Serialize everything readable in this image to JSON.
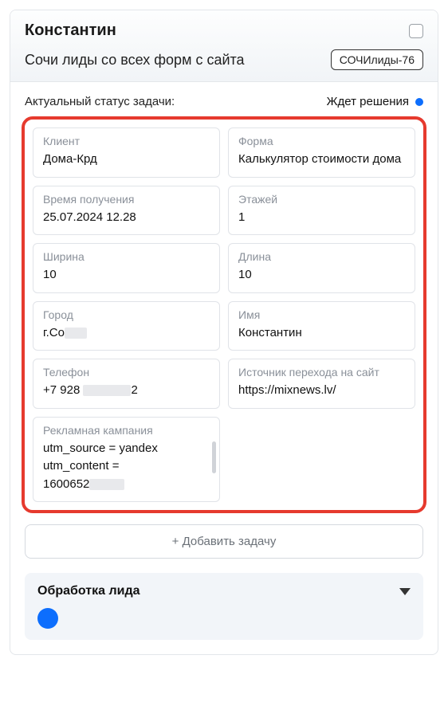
{
  "header": {
    "title": "Константин",
    "subtitle": "Сочи лиды со всех форм с сайта",
    "tag": "СОЧИлиды-76"
  },
  "status": {
    "label": "Актуальный статус задачи:",
    "value": "Ждет решения"
  },
  "fields": {
    "left": [
      {
        "label": "Клиент",
        "value": "Дома-Крд"
      },
      {
        "label": "Время получения",
        "value": "25.07.2024 12.28"
      },
      {
        "label": "Ширина",
        "value": "10"
      },
      {
        "label": "Город",
        "value_prefix": "г.Со",
        "redacted": true
      },
      {
        "label": "Телефон",
        "value_prefix": "+7 928",
        "value_suffix": "2",
        "redacted": true
      },
      {
        "label": "Рекламная кампания",
        "value_lines": [
          "utm_source = yandex",
          "utm_content ="
        ],
        "value_last_prefix": "1600652",
        "redacted": true,
        "has_scroll": true
      }
    ],
    "right": [
      {
        "label": "Форма",
        "value": "Калькулятор стоимости дома"
      },
      {
        "label": "Этажей",
        "value": "1"
      },
      {
        "label": "Длина",
        "value": "10"
      },
      {
        "label": "Имя",
        "value": "Константин"
      },
      {
        "label": "Источник перехода на сайт",
        "value": "https://mixnews.lv/"
      }
    ]
  },
  "add_task_label": "+ Добавить задачу",
  "section": {
    "title": "Обработка лида"
  }
}
